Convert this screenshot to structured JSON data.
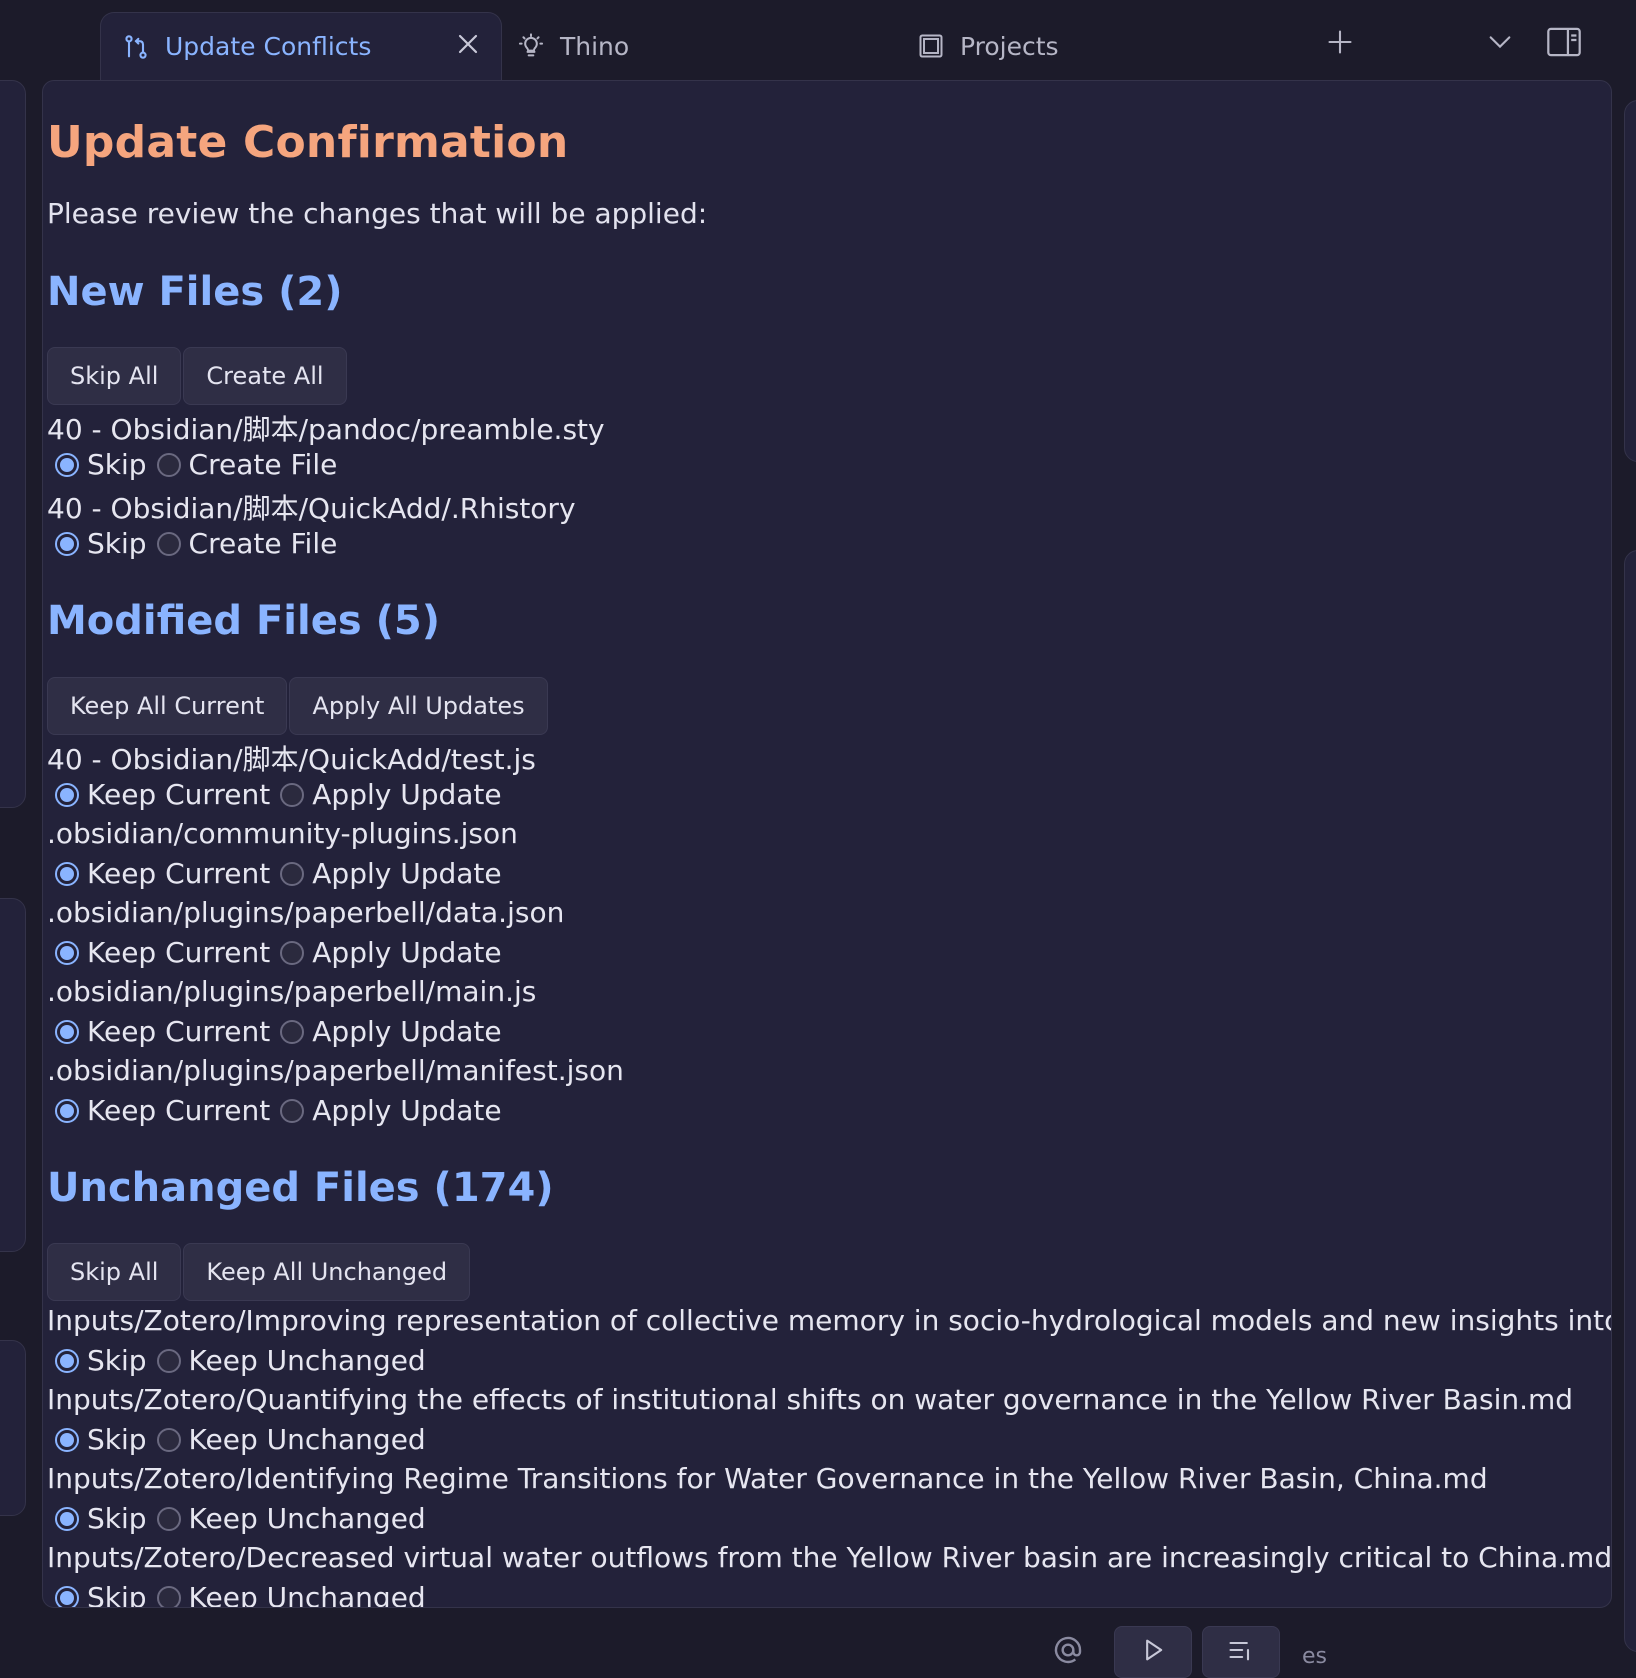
{
  "tabs": {
    "active": {
      "label": "Update Conflicts"
    },
    "thino": {
      "label": "Thino"
    },
    "projects": {
      "label": "Projects"
    }
  },
  "page": {
    "title": "Update Confirmation",
    "intro": "Please review the changes that will be applied:"
  },
  "new_files": {
    "heading": "New Files (2)",
    "buttons": [
      "Skip All",
      "Create All"
    ],
    "items": [
      {
        "path": "40 - Obsidian/脚本/pandoc/preamble.sty",
        "opt1": "Skip",
        "opt2": "Create File",
        "selected": "Skip"
      },
      {
        "path": "40 - Obsidian/脚本/QuickAdd/.Rhistory",
        "opt1": "Skip",
        "opt2": "Create File",
        "selected": "Skip"
      }
    ]
  },
  "modified_files": {
    "heading": "Modified Files (5)",
    "buttons": [
      "Keep All Current",
      "Apply All Updates"
    ],
    "items": [
      {
        "path": "40 - Obsidian/脚本/QuickAdd/test.js",
        "opt1": "Keep Current",
        "opt2": "Apply Update",
        "selected": "Keep Current"
      },
      {
        "path": ".obsidian/community-plugins.json",
        "opt1": "Keep Current",
        "opt2": "Apply Update",
        "selected": "Keep Current"
      },
      {
        "path": ".obsidian/plugins/paperbell/data.json",
        "opt1": "Keep Current",
        "opt2": "Apply Update",
        "selected": "Keep Current"
      },
      {
        "path": ".obsidian/plugins/paperbell/main.js",
        "opt1": "Keep Current",
        "opt2": "Apply Update",
        "selected": "Keep Current"
      },
      {
        "path": ".obsidian/plugins/paperbell/manifest.json",
        "opt1": "Keep Current",
        "opt2": "Apply Update",
        "selected": "Keep Current"
      }
    ]
  },
  "unchanged_files": {
    "heading": "Unchanged Files (174)",
    "buttons": [
      "Skip All",
      "Keep All Unchanged"
    ],
    "items": [
      {
        "path": "Inputs/Zotero/Improving representation of collective memory in socio-hydrological models and new insights into .md",
        "opt1": "Skip",
        "opt2": "Keep Unchanged",
        "selected": "Skip"
      },
      {
        "path": "Inputs/Zotero/Quantifying the effects of institutional shifts on water governance in the Yellow River Basin.md",
        "opt1": "Skip",
        "opt2": "Keep Unchanged",
        "selected": "Skip"
      },
      {
        "path": "Inputs/Zotero/Identifying Regime Transitions for Water Governance in the Yellow River Basin, China.md",
        "opt1": "Skip",
        "opt2": "Keep Unchanged",
        "selected": "Skip"
      },
      {
        "path": "Inputs/Zotero/Decreased virtual water outflows from the Yellow River basin are increasingly critical to China.md",
        "opt1": "Skip",
        "opt2": "Keep Unchanged",
        "selected": "Skip"
      }
    ]
  },
  "status_bar": {
    "label": "es"
  },
  "colors": {
    "accent": "#8ab4ff",
    "title": "#f5a57e",
    "background": "#1c1b2a",
    "panel": "#23223a"
  }
}
